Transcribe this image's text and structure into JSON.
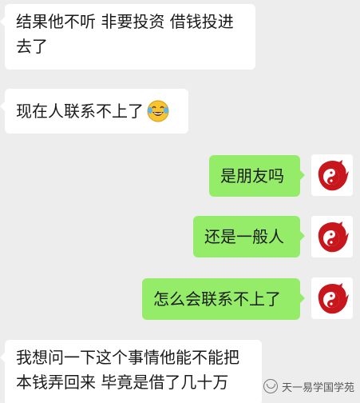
{
  "colors": {
    "background": "#ededed",
    "incoming_bubble": "#ffffff",
    "outgoing_bubble": "#95ec69",
    "avatar_red": "#c8161d"
  },
  "messages": [
    {
      "side": "in",
      "text": "结果他不听 非要投资 借钱投进\n去了"
    },
    {
      "side": "in",
      "text": "现在人联系不上了",
      "emoji": "laughing-crying-emoji"
    },
    {
      "side": "out",
      "text": "是朋友吗"
    },
    {
      "side": "out",
      "text": "还是一般人"
    },
    {
      "side": "out",
      "text": "怎么会联系不上了"
    },
    {
      "side": "in",
      "text": "我想问一下这个事情他能不能把\n本钱弄回来 毕竟是借了几十万"
    }
  ],
  "avatar": {
    "icon": "red-dragon-yin-yang-icon"
  },
  "watermark": {
    "text": "天一易学国学苑",
    "icon": "wechat-channel-icon"
  }
}
